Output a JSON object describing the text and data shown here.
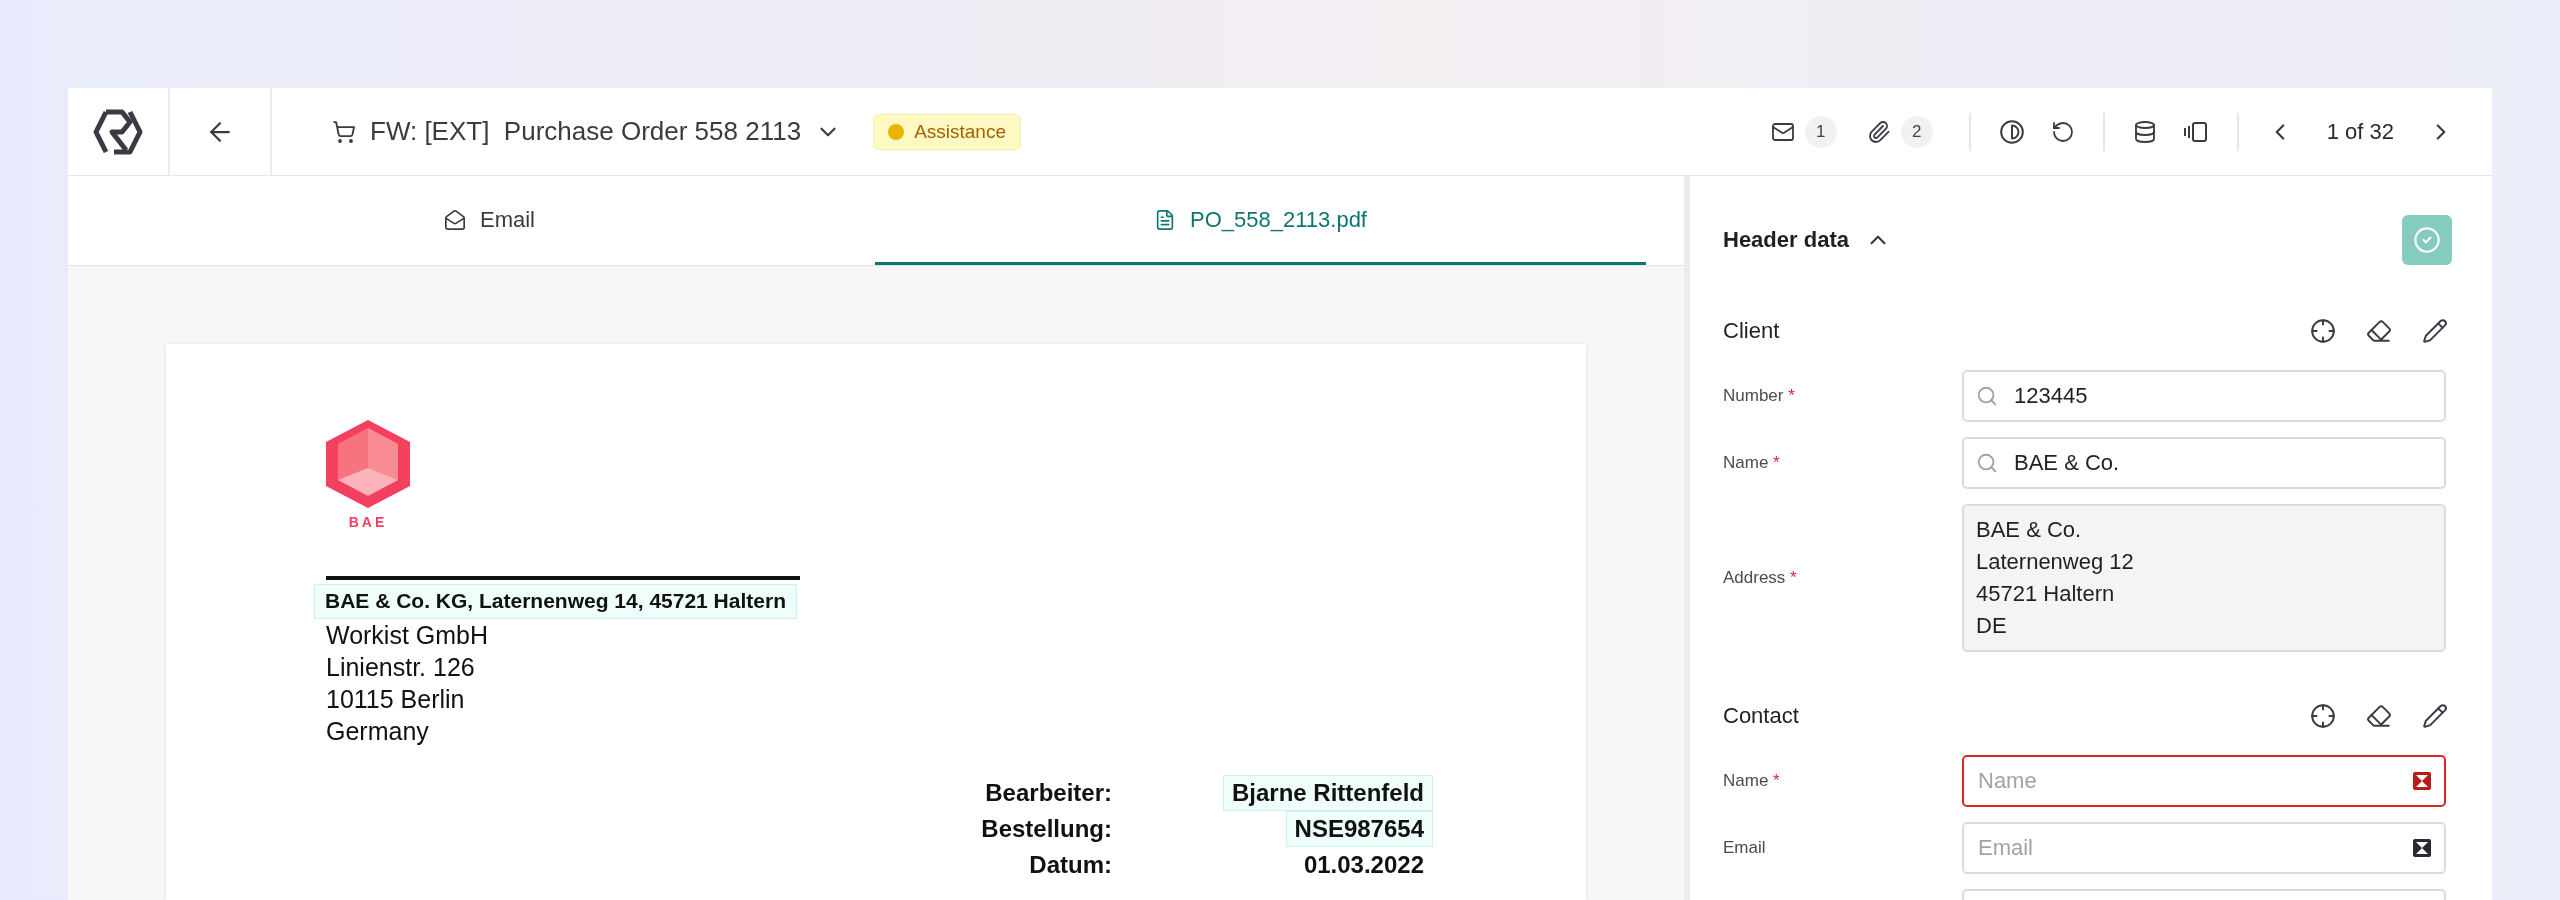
{
  "toolbar": {
    "title": "FW: [EXT]  Purchase Order 558 2113",
    "status": "Assistance",
    "counters": [
      {
        "kind": "mail",
        "count": "1"
      },
      {
        "kind": "attachment",
        "count": "2"
      }
    ],
    "pagination": "1 of 32"
  },
  "tabs": [
    {
      "label": "Email",
      "kind": "email",
      "selected": false
    },
    {
      "label": "PO_558_2113.pdf",
      "kind": "file",
      "selected": true
    }
  ],
  "document": {
    "logo_text": "BAE",
    "sender_line": "BAE & Co. KG, Laternenweg 14, 45721 Haltern",
    "recipient": [
      "Workist GmbH",
      "Linienstr. 126",
      "10115 Berlin",
      "Germany"
    ],
    "details": [
      {
        "label": "Bearbeiter:",
        "value": "Bjarne Rittenfeld",
        "highlighted": true
      },
      {
        "label": "Bestellung:",
        "value": "NSE987654",
        "highlighted": true
      },
      {
        "label": "Datum:",
        "value": "01.03.2022",
        "highlighted": false
      }
    ]
  },
  "panel": {
    "title": "Header data",
    "expanded": true,
    "required_mark": "*",
    "sections": [
      {
        "title": "Client",
        "fields": [
          {
            "kind": "search",
            "label": "Number",
            "required": true,
            "value": "123445",
            "error": false
          },
          {
            "kind": "search",
            "label": "Name",
            "required": true,
            "value": "BAE & Co.",
            "error": false
          },
          {
            "kind": "address",
            "label": "Address",
            "required": true,
            "lines": [
              "BAE & Co.",
              "Laternenweg 12",
              "45721 Haltern",
              "DE"
            ],
            "error": false
          }
        ]
      },
      {
        "title": "Contact",
        "fields": [
          {
            "kind": "clearable",
            "label": "Name",
            "required": true,
            "placeholder": "Name",
            "error": true
          },
          {
            "kind": "clearable",
            "label": "Email",
            "required": false,
            "placeholder": "Email",
            "error": false
          },
          {
            "kind": "text",
            "error": false
          }
        ]
      }
    ]
  }
}
